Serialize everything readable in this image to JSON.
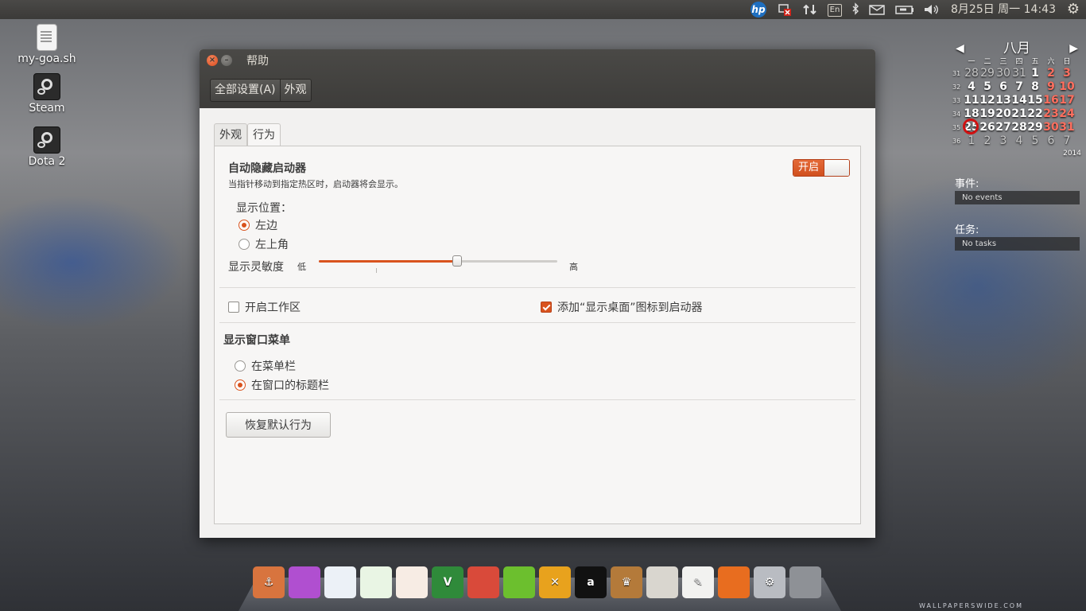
{
  "top_panel": {
    "hp_label": "hp",
    "keyboard_label": "En",
    "datetime": "8月25日 周一 14:43"
  },
  "desktop": {
    "icons": [
      {
        "label": "my-goa.sh"
      },
      {
        "label": "Steam"
      },
      {
        "label": "Dota 2"
      }
    ]
  },
  "calendar": {
    "month": "八月",
    "weekdays": [
      "一",
      "二",
      "三",
      "四",
      "五",
      "六",
      "日"
    ],
    "weeks": [
      {
        "num": "31",
        "days": [
          "28",
          "29",
          "30",
          "31",
          "1",
          "2",
          "3"
        ]
      },
      {
        "num": "32",
        "days": [
          "4",
          "5",
          "6",
          "7",
          "8",
          "9",
          "10"
        ]
      },
      {
        "num": "33",
        "days": [
          "11",
          "12",
          "13",
          "14",
          "15",
          "16",
          "17"
        ]
      },
      {
        "num": "34",
        "days": [
          "18",
          "19",
          "20",
          "21",
          "22",
          "23",
          "24"
        ]
      },
      {
        "num": "35",
        "days": [
          "25",
          "26",
          "27",
          "28",
          "29",
          "30",
          "31"
        ]
      },
      {
        "num": "36",
        "days": [
          "1",
          "2",
          "3",
          "4",
          "5",
          "6",
          "7"
        ]
      }
    ],
    "today": "25",
    "year": "2014",
    "events_title": "事件:",
    "events_empty": "No events",
    "tasks_title": "任务:",
    "tasks_empty": "No tasks"
  },
  "window": {
    "title": "帮助",
    "close_glyph": "×",
    "minimize_glyph": "–",
    "breadcrumbs": [
      "全部设置(A)",
      "外观"
    ],
    "tabs": [
      "外观",
      "行为"
    ],
    "active_tab": "行为",
    "autohide": {
      "title": "自动隐藏启动器",
      "description": "当指针移动到指定热区时，启动器将会显示。",
      "switch_label": "开启",
      "position_label": "显示位置：",
      "position_options": [
        "左边",
        "左上角"
      ],
      "position_selected": "左边",
      "sensitivity_label": "显示灵敏度",
      "sensitivity_low": "低",
      "sensitivity_high": "高",
      "sensitivity_value": 0.58
    },
    "workspaces_label": "开启工作区",
    "workspaces_checked": false,
    "show_desktop_label": "添加“显示桌面”图标到启动器",
    "show_desktop_checked": true,
    "menu_section": {
      "title": "显示窗口菜单",
      "options": [
        "在菜单栏",
        "在窗口的标题栏"
      ],
      "selected": "在窗口的标题栏"
    },
    "restore_button": "恢复默认行为"
  },
  "dock": {
    "apps": [
      {
        "name": "anchor-app-icon",
        "color": "#d8743e",
        "glyph": "⚓"
      },
      {
        "name": "video-player-icon",
        "color": "#b04fd0",
        "glyph": ""
      },
      {
        "name": "libreoffice-writer-icon",
        "color": "#ecf1f7",
        "glyph": ""
      },
      {
        "name": "libreoffice-calc-icon",
        "color": "#e9f5e4",
        "glyph": ""
      },
      {
        "name": "libreoffice-impress-icon",
        "color": "#f7ece4",
        "glyph": ""
      },
      {
        "name": "vim-icon",
        "color": "#2f8a3a",
        "glyph": "V"
      },
      {
        "name": "chrome-icon",
        "color": "#d94a3a",
        "glyph": ""
      },
      {
        "name": "leaf-app-icon",
        "color": "#6cbf2e",
        "glyph": ""
      },
      {
        "name": "xchat-icon",
        "color": "#e8a21d",
        "glyph": "✕"
      },
      {
        "name": "amarok-icon",
        "color": "#111111",
        "glyph": "a"
      },
      {
        "name": "chess-icon",
        "color": "#b47a3a",
        "glyph": "♛"
      },
      {
        "name": "file-cabinet-icon",
        "color": "#d9d6cf",
        "glyph": ""
      },
      {
        "name": "text-editor-icon",
        "color": "#f2f2f0",
        "glyph": "✎"
      },
      {
        "name": "firefox-icon",
        "color": "#e86d1f",
        "glyph": ""
      },
      {
        "name": "system-settings-icon",
        "color": "#b9bcc2",
        "glyph": "⚙"
      },
      {
        "name": "trash-icon",
        "color": "#8e9196",
        "glyph": ""
      }
    ]
  },
  "watermark": "WALLPAPERSWIDE.COM"
}
